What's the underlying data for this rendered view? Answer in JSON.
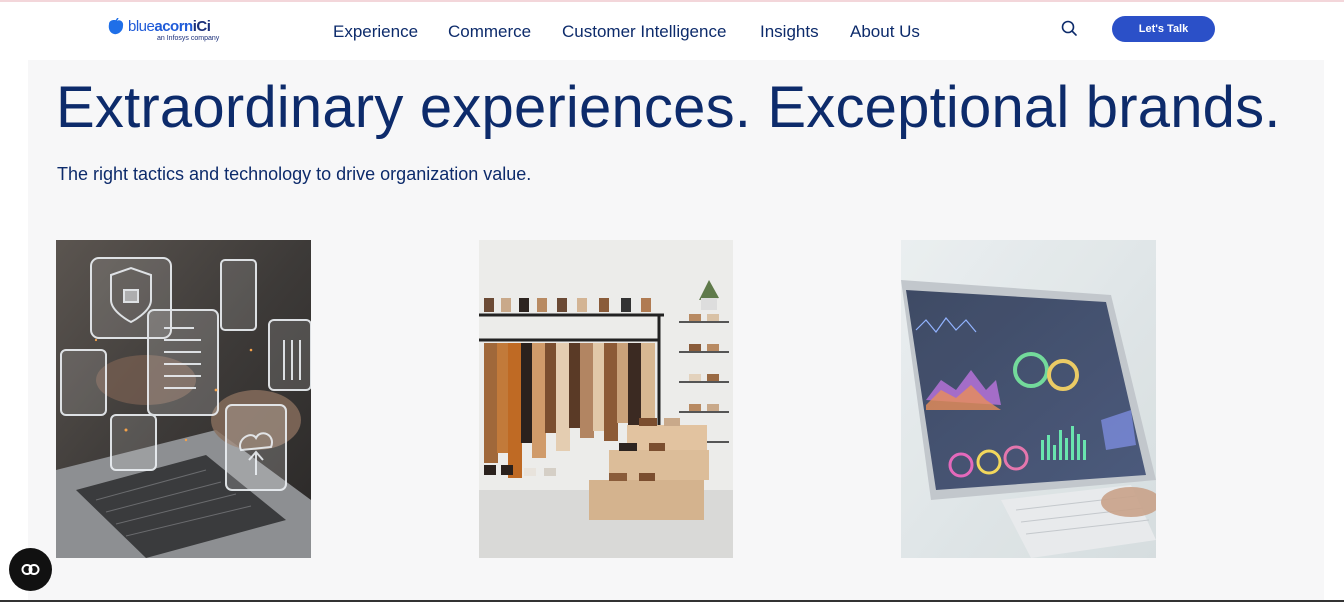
{
  "brand": {
    "logo_word_blue": "blue",
    "logo_word_acorn": "acorn",
    "logo_word_ici": "iCi",
    "logo_tagline": "an Infosys company"
  },
  "nav": {
    "items": [
      {
        "label": "Experience"
      },
      {
        "label": "Commerce"
      },
      {
        "label": "Customer Intelligence"
      },
      {
        "label": "Insights"
      },
      {
        "label": "About Us"
      }
    ]
  },
  "header": {
    "search_icon": "search-icon",
    "cta_label": "Let's Talk",
    "cta_color": "#2b50c8"
  },
  "hero": {
    "title": "Extraordinary experiences. Exceptional brands.",
    "subtitle": "The right tactics and technology to drive organization value.",
    "text_color": "#0d2b6b",
    "background": "#f7f7f8"
  },
  "cards": [
    {
      "image": "laptop-security-icons-image"
    },
    {
      "image": "clothing-rack-store-image"
    },
    {
      "image": "tablet-dashboard-analytics-image"
    }
  ],
  "accessibility": {
    "icon": "accessibility-toggle-icon"
  }
}
